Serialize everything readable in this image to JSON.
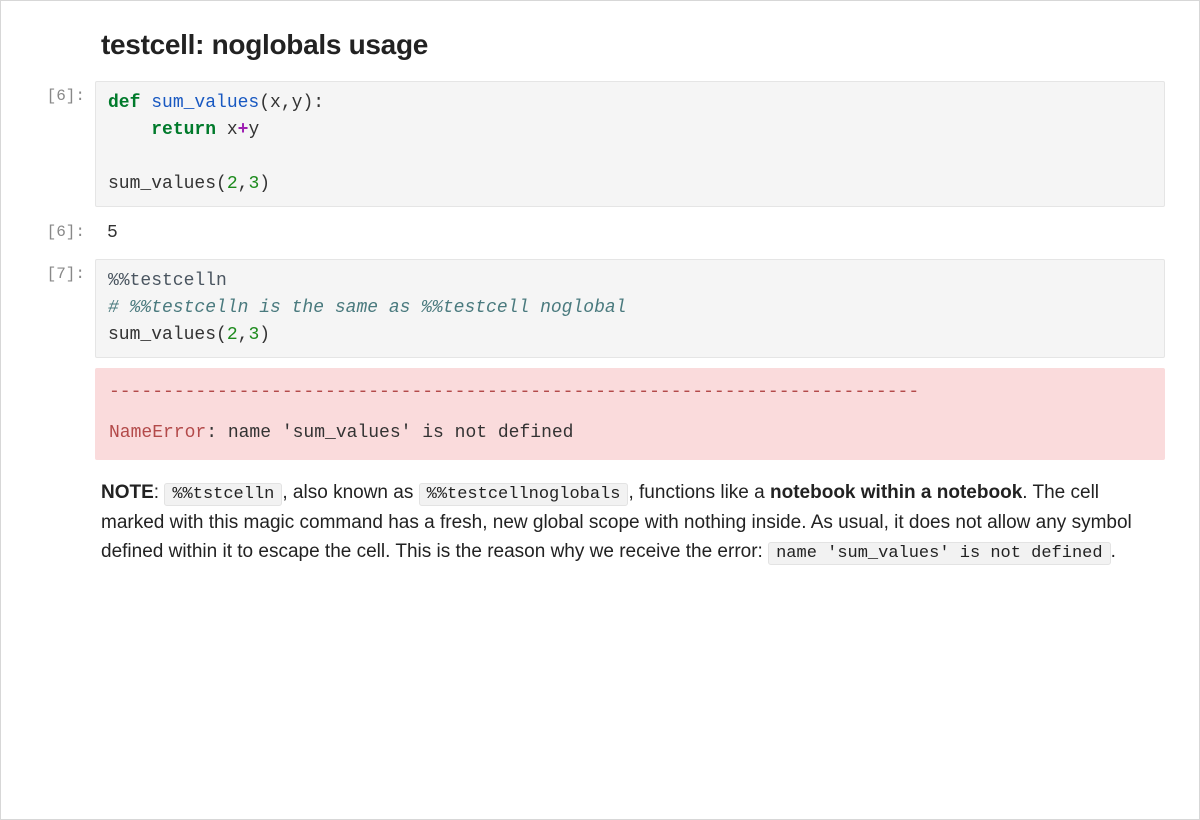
{
  "title": "testcell: noglobals usage",
  "cells": [
    {
      "prompt": "[6]:",
      "code": {
        "line1_def": "def",
        "line1_fn": "sum_values",
        "line1_rest": "(x,y):",
        "line2_indent": "    ",
        "line2_return": "return",
        "line2_space": " x",
        "line2_plus": "+",
        "line2_y": "y",
        "line4": "sum_values(",
        "line4_n1": "2",
        "line4_c": ",",
        "line4_n2": "3",
        "line4_close": ")"
      }
    },
    {
      "prompt": "[6]:",
      "output": "5"
    },
    {
      "prompt": "[7]:",
      "code": {
        "magic": "%%testcelln",
        "comment": "# %%testcelln is the same as %%testcell noglobal",
        "call_pre": "sum_values(",
        "n1": "2",
        "comma": ",",
        "n2": "3",
        "close": ")"
      },
      "error": {
        "dash": "---------------------------------------------------------------------------",
        "name": "NameError",
        "msg": ": name 'sum_values' is not defined"
      }
    }
  ],
  "note": {
    "label": "NOTE",
    "code1": "%%tstcelln",
    "mid1": ", also known as ",
    "code2": "%%testcellnoglobals",
    "mid2": ", functions like a ",
    "bold1": "notebook within a notebook",
    "mid3": ". The cell marked with this magic command has a fresh, new global scope with nothing inside. As usual, it does not allow any symbol defined within it to escape the cell. This is the reason why we receive the error: ",
    "code3": "name 'sum_values' is not defined",
    "end": "."
  }
}
